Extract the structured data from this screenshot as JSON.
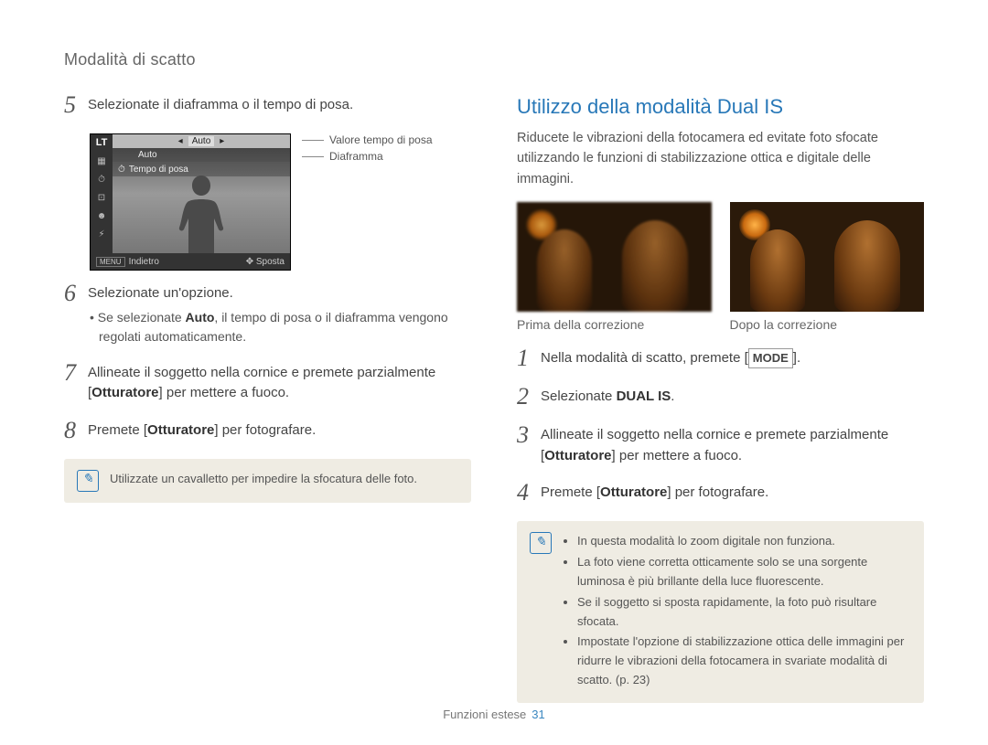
{
  "page_title": "Modalità di scatto",
  "left": {
    "step5": "Selezionate il diaframma o il tempo di posa.",
    "lcd": {
      "lt": "LT",
      "auto1": "Auto",
      "auto2": "Auto",
      "tempo": "Tempo di posa",
      "back": "Indietro",
      "menu": "MENU",
      "move": "Sposta"
    },
    "callout1": "Valore tempo di posa",
    "callout2": "Diaframma",
    "step6": "Selezionate un'opzione.",
    "step6_sub_a": "Se selezionate ",
    "step6_sub_bold": "Auto",
    "step6_sub_b": ", il tempo di posa o il diaframma vengono regolati automaticamente.",
    "step7_a": "Allineate il soggetto nella cornice e premete parzialmente [",
    "step7_bold": "Otturatore",
    "step7_b": "] per mettere a fuoco.",
    "step8_a": "Premete [",
    "step8_bold": "Otturatore",
    "step8_b": "] per fotografare.",
    "note": "Utilizzate un cavalletto per impedire la sfocatura delle foto."
  },
  "right": {
    "heading": "Utilizzo della modalità Dual IS",
    "intro": "Riducete le vibrazioni della fotocamera ed evitate foto sfocate utilizzando le funzioni di stabilizzazione ottica e digitale delle immagini.",
    "cap_before": "Prima della correzione",
    "cap_after": "Dopo la correzione",
    "step1_a": "Nella modalità di scatto, premete [",
    "step1_btn": "MODE",
    "step1_b": "].",
    "step2_a": "Selezionate ",
    "step2_bold": "DUAL IS",
    "step2_b": ".",
    "step3_a": "Allineate il soggetto nella cornice e premete parzialmente [",
    "step3_bold": "Otturatore",
    "step3_b": "] per mettere a fuoco.",
    "step4_a": "Premete [",
    "step4_bold": "Otturatore",
    "step4_b": "] per fotografare.",
    "notes": {
      "n1": "In questa modalità lo zoom digitale non funziona.",
      "n2": "La foto viene corretta otticamente solo se una sorgente luminosa è più brillante della luce fluorescente.",
      "n3": "Se il soggetto si sposta rapidamente, la foto può risultare sfocata.",
      "n4": "Impostate l'opzione di stabilizzazione ottica delle immagini per ridurre le vibrazioni della fotocamera in svariate modalità di scatto. (p. 23)"
    }
  },
  "footer": {
    "section": "Funzioni estese",
    "page": "31"
  }
}
